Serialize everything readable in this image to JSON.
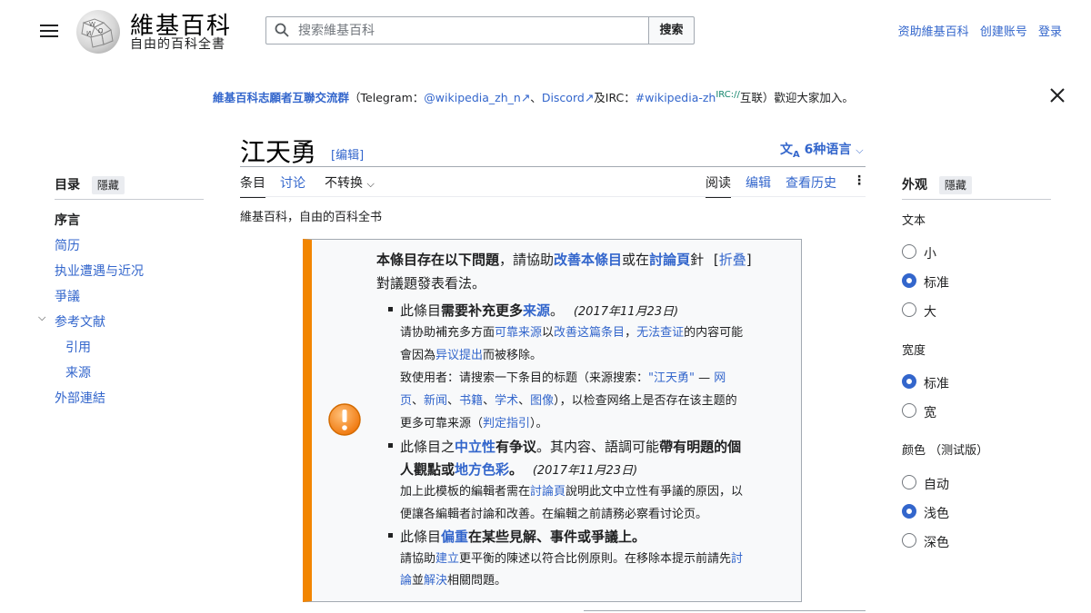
{
  "header": {
    "logo_title": "維基百科",
    "logo_tagline": "自由的百科全書",
    "search_placeholder": "搜索維基百科",
    "search_button": "搜索",
    "links": [
      "资助維基百科",
      "创建账号",
      "登录"
    ]
  },
  "sitenotice": {
    "lead": "維基百科志願者互聯交流群",
    "p1": "（Telegram：",
    "telegram": "@wikipedia_zh_n",
    "p2": "、",
    "discord": "Discord",
    "p3": "及IRC：",
    "irc": "#wikipedia-zh",
    "irc_sup": "IRC://",
    "p4": "互联）歡迎大家加入。"
  },
  "article": {
    "title": "江天勇",
    "edit_label": "[编辑]",
    "languages": "6种语言",
    "subtitle": "維基百科，自由的百科全书",
    "tabs_left": [
      "条目",
      "讨论",
      "不转换"
    ],
    "tabs_right": [
      "阅读",
      "编辑",
      "查看历史"
    ]
  },
  "toc": {
    "title": "目录",
    "hide": "隱藏",
    "items": [
      "序言",
      "简历",
      "执业遭遇与近况",
      "爭議",
      "参考文献",
      "引用",
      "来源",
      "外部連結"
    ]
  },
  "ambox": {
    "header_bold": "本條目存在以下問題",
    "header_mid": "，請協助",
    "header_link1": "改善本條目",
    "header_or": "或在",
    "header_link2": "討論頁",
    "header_end": "針",
    "collapse": "折叠",
    "header_line2": "對議題發表看法。",
    "i1_pre": "此條目",
    "i1_bold": "需要补充更多",
    "i1_link": "来源",
    "i1_end": "。",
    "i1_date": "(2017年11月23日)",
    "i1_d1_pre": "请协助補充多方面",
    "i1_d1_l1": "可靠来源",
    "i1_d1_mid": "以",
    "i1_d1_l2": "改善这篇条目",
    "i1_d1_comma": "，",
    "i1_d1_l3": "无法查证",
    "i1_d1_end": "的内容可能",
    "i1_d2_pre": "會因為",
    "i1_d2_link": "异议提出",
    "i1_d2_end": "而被移除。",
    "i1_d3_pre": "致使用者：请搜索一下条目的标题（来源搜索：",
    "i1_d3_q": "\"江天勇\"",
    "i1_d3_dash": " — ",
    "i1_d3_web": "网",
    "i1_d4_a": "页",
    "i1_d4_b": "新闻",
    "i1_d4_c": "书籍",
    "i1_d4_d": "学术",
    "i1_d4_e": "图像",
    "i1_d4_end": "），以检查网络上是否存在该主题的",
    "i1_d5_pre": "更多可靠来源（",
    "i1_d5_link": "判定指引",
    "i1_d5_end": "）。",
    "i2_pre": "此條目之",
    "i2_link": "中立性",
    "i2_bold": "有争议",
    "i2_mid": "。其内容、語調可能",
    "i2_bold2": "帶有明題的個",
    "i2_l2_a": "人觀點或",
    "i2_l2_link": "地方色彩",
    "i2_l2_end": "。",
    "i2_date": "(2017年11月23日)",
    "i2_d1_pre": "加上此模板的編輯者需在",
    "i2_d1_link": "討論頁",
    "i2_d1_end": "說明此文中立性有爭議的原因，以",
    "i2_d2": "便讓各編輯者討論和改善。在編輯之前請務必察看讨论页。",
    "i3_pre": "此條目",
    "i3_link": "偏重",
    "i3_bold": "在某些見解、事件或爭議上",
    "i3_end": "。",
    "i3_d1_pre": "請協助",
    "i3_d1_link": "建立",
    "i3_d1_mid": "更平衡的陳述以符合比例原則。在移除本提示前請先",
    "i3_d1_link2": "討",
    "i3_d2_link": "論",
    "i3_d2_mid": "並",
    "i3_d2_link2": "解決",
    "i3_d2_end": "相關問題。"
  },
  "appearance": {
    "title": "外观",
    "hide": "隱藏",
    "text_head": "文本",
    "text_opts": [
      "小",
      "标准",
      "大"
    ],
    "width_head": "宽度",
    "width_opts": [
      "标准",
      "宽"
    ],
    "color_head": "颜色 （测试版）",
    "color_opts": [
      "自动",
      "浅色",
      "深色"
    ]
  }
}
